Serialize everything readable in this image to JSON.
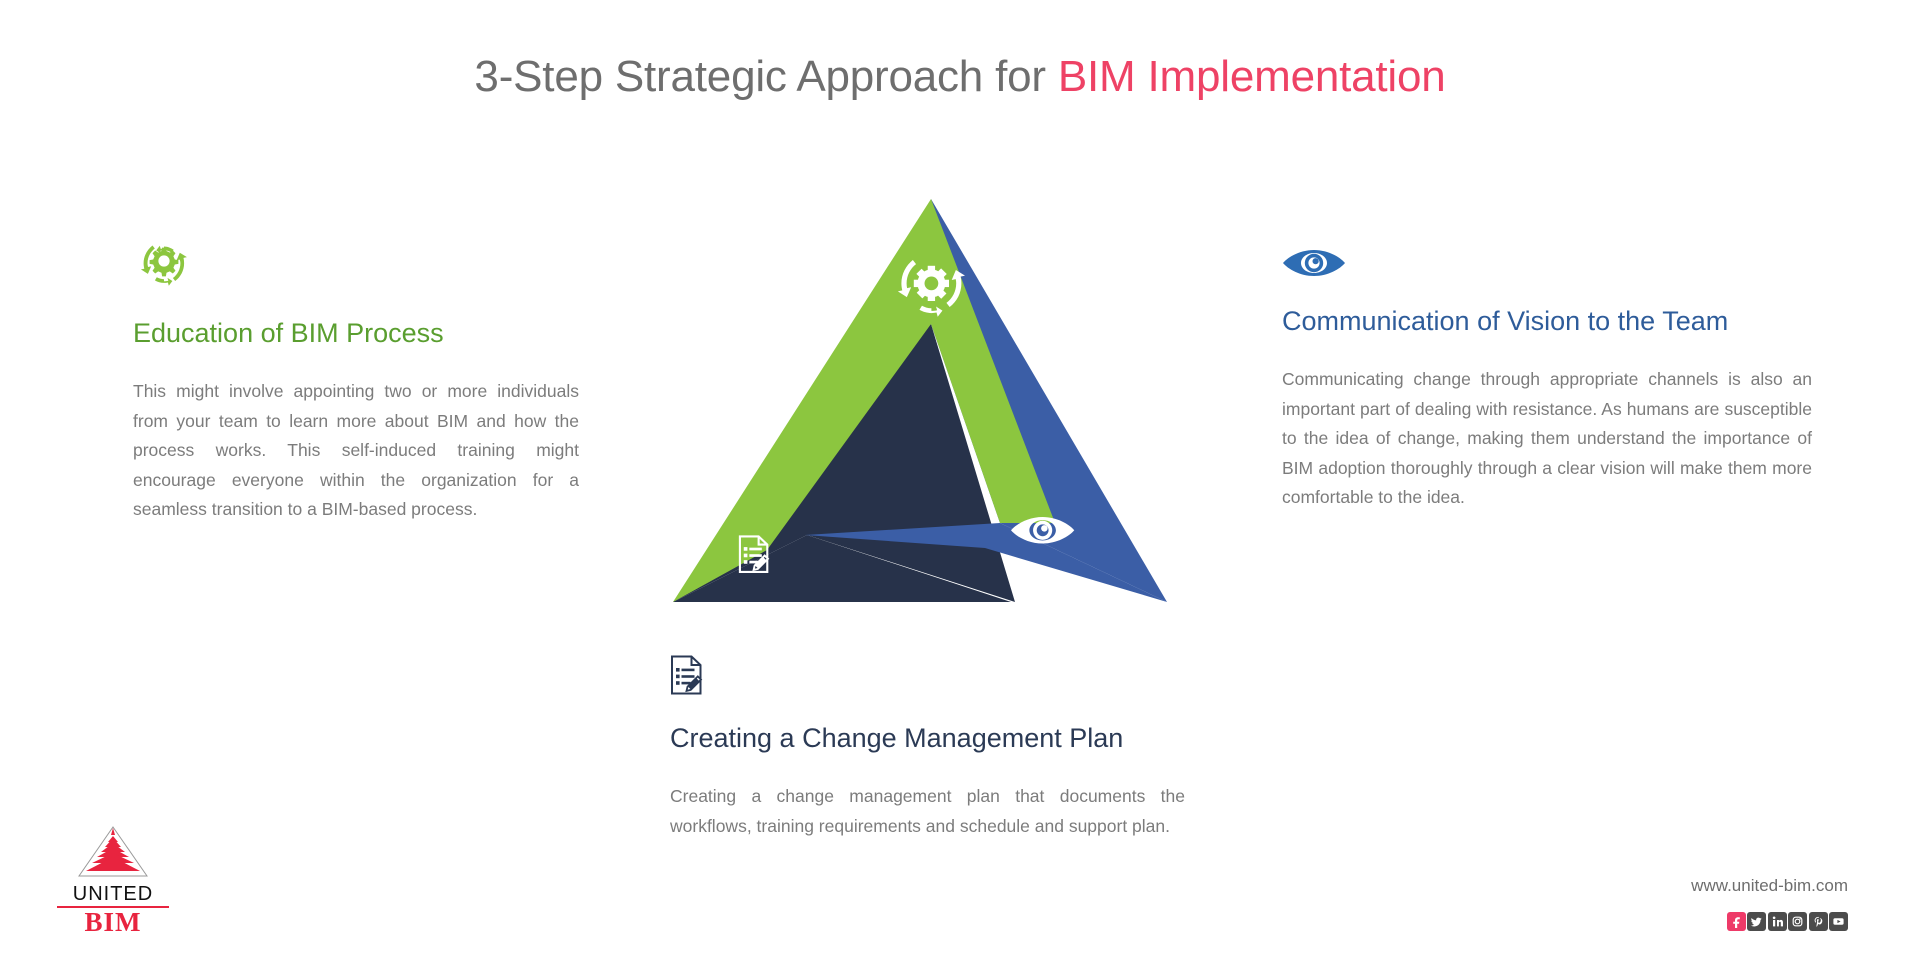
{
  "title": {
    "prefix": "3-Step Strategic Approach for ",
    "accent": "BIM Implementation",
    "accent_color": "#EE4265",
    "base_color": "#6E6E6E"
  },
  "steps": [
    {
      "id": "education",
      "icon": "gear-recycle-icon",
      "icon_color": "#8CC63F",
      "heading": "Education of BIM Process",
      "heading_color": "#5A9E2F",
      "body": "This might involve appointing two or more individuals from your team to learn more about BIM and how the process works. This self-induced training might encourage everyone within the organization for a seamless transition to a BIM-based process."
    },
    {
      "id": "communication",
      "icon": "eye-icon",
      "icon_color": "#2E6DB4",
      "heading": "Communication of Vision to the Team",
      "heading_color": "#2E5C9A",
      "body": "Communicating change through appropriate channels is also an important part of dealing with resistance. As humans are susceptible to the idea of change, making them understand the importance of BIM adoption thoroughly through a clear vision will make them more comfortable to the idea."
    },
    {
      "id": "change-plan",
      "icon": "document-pencil-icon",
      "icon_color": "#2B3A55",
      "heading": "Creating a Change Management Plan",
      "heading_color": "#2B3A55",
      "body": "Creating a change management plan that documents the workflows, training requirements and schedule and support plan."
    }
  ],
  "diagram": {
    "name": "three-step-triangle",
    "segments": [
      {
        "label": "Education of BIM Process",
        "color": "#8CC63F",
        "icon": "gear-recycle-icon",
        "position": "left-edge"
      },
      {
        "label": "Communication of Vision to the Team",
        "color": "#3B5EA6",
        "icon": "eye-icon",
        "position": "right-edge"
      },
      {
        "label": "Creating a Change Management Plan",
        "color": "#27324A",
        "icon": "document-pencil-icon",
        "position": "bottom-edge"
      }
    ]
  },
  "footer": {
    "logo": {
      "mark": "pyramid-icon",
      "united": "UNITED",
      "bim": "BIM",
      "mark_color": "#E8243F"
    },
    "url": "www.united-bim.com",
    "social": [
      {
        "name": "facebook",
        "glyph": "f"
      },
      {
        "name": "twitter",
        "glyph": "t"
      },
      {
        "name": "linkedin",
        "glyph": "in"
      },
      {
        "name": "instagram",
        "glyph": "ig"
      },
      {
        "name": "pinterest",
        "glyph": "P"
      },
      {
        "name": "youtube",
        "glyph": "yt"
      }
    ]
  }
}
